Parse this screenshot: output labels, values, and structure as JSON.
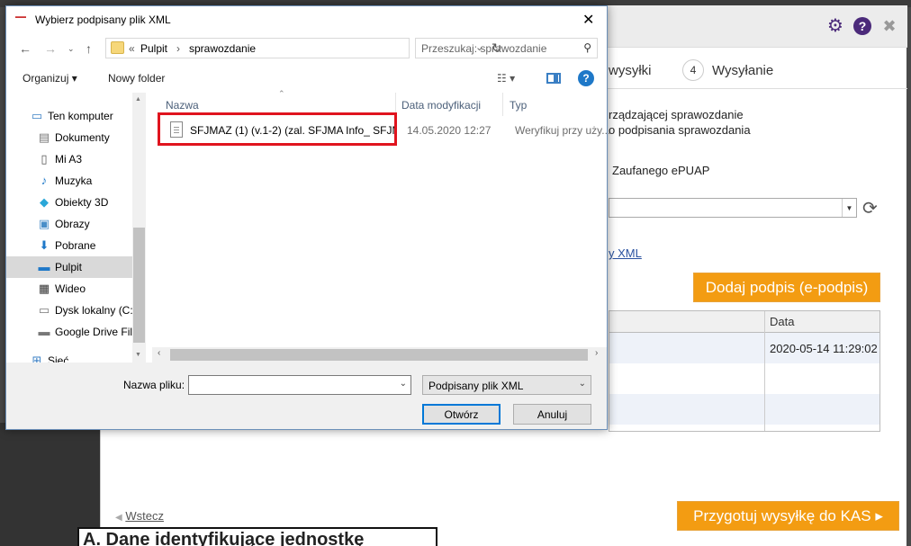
{
  "app": {
    "step_3_label": "wysyłki",
    "step_4_number": "4",
    "step_4_label": "Wysyłanie",
    "text_line_1": "rządzającej sprawozdanie",
    "text_line_2": "o podpisania sprawozdania",
    "text_epuap": "Zaufanego ePUAP",
    "link_xml": "y XML",
    "sign_button": "Dodaj podpis (e-podpis)",
    "table": {
      "header": "Data",
      "row1_date": "2020-05-14 11:29:02"
    },
    "back_label": "Wstecz",
    "kas_button": "Przygotuj wysyłkę do KAS ▸",
    "bottom_text": "A. Dane identyfikujące jednostkę",
    "header_icons": [
      "gear-icon",
      "help-icon",
      "close-icon"
    ]
  },
  "dialog": {
    "title": "Wybierz podpisany plik XML",
    "address": {
      "prefix": "«",
      "segment_1": "Pulpit",
      "separator": "›",
      "segment_2": "sprawozdanie"
    },
    "search_placeholder": "Przeszukaj: sprawozdanie",
    "toolbar": {
      "organize": "Organizuj ▾",
      "new_folder": "Nowy folder"
    },
    "nav_items": [
      {
        "label": "Ten komputer",
        "icon": "computer-icon"
      },
      {
        "label": "Dokumenty",
        "icon": "documents-icon"
      },
      {
        "label": "Mi A3",
        "icon": "phone-icon"
      },
      {
        "label": "Muzyka",
        "icon": "music-icon"
      },
      {
        "label": "Obiekty 3D",
        "icon": "cube-icon"
      },
      {
        "label": "Obrazy",
        "icon": "pictures-icon"
      },
      {
        "label": "Pobrane",
        "icon": "download-icon"
      },
      {
        "label": "Pulpit",
        "icon": "desktop-icon",
        "selected": true
      },
      {
        "label": "Wideo",
        "icon": "video-icon"
      },
      {
        "label": "Dysk lokalny (C:)",
        "icon": "drive-icon"
      },
      {
        "label": "Google Drive File",
        "icon": "drive-icon"
      },
      {
        "label": "Sieć",
        "icon": "network-icon"
      }
    ],
    "columns": [
      "Nazwa",
      "Data modyfikacji",
      "Typ"
    ],
    "files": [
      {
        "name": "SFJMAZ (1) (v.1-2) (zal. SFJMA Info_ SFJM...",
        "date": "14.05.2020 12:27",
        "type": "Weryfikuj przy uży..."
      }
    ],
    "filename_label": "Nazwa pliku:",
    "filename_value": "",
    "filter_value": "Podpisany plik XML",
    "open_button": "Otwórz",
    "cancel_button": "Anuluj"
  },
  "colors": {
    "accent_orange": "#f39c12",
    "brand_purple": "#4b2a7a",
    "highlight_red": "#e0141e",
    "windows_blue": "#0078d7"
  }
}
